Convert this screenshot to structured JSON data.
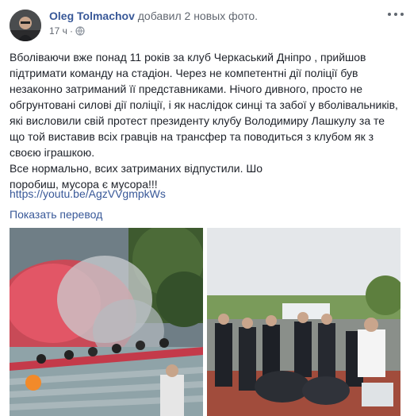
{
  "post": {
    "author": "Oleg Tolmachov",
    "action": "добавил 2 новых фото.",
    "timestamp": "17 ч",
    "separator": "·",
    "privacy_icon": "globe-icon",
    "more_icon": "more-options-icon",
    "text_lines": [
      "Вболіваючи вже понад 11 років за клуб Черкаський Дніпро , прийшов підтримати команду на стадіон. Через не компетентні дії поліції був незаконно затриманий її представниками. Нічого дивного, просто не обгрунтовані силові дії поліції, і як наслідок синці та забої у вболівальників, які висловили свій протест президенту клубу Володимиру Лашкулу за те що той виставив всіх гравців на трансфер та поводиться з клубом як з своєю іграшкою.",
      "Все нормально, всих затриманих відпустили. Шо",
      "поробиш, мусора є мусора!!!"
    ],
    "link": "https://youtu.be/AgzVVgmpkWs",
    "translate_label": "Показать перевод"
  },
  "colors": {
    "link": "#385898",
    "text": "#1d2129",
    "meta": "#616770"
  }
}
